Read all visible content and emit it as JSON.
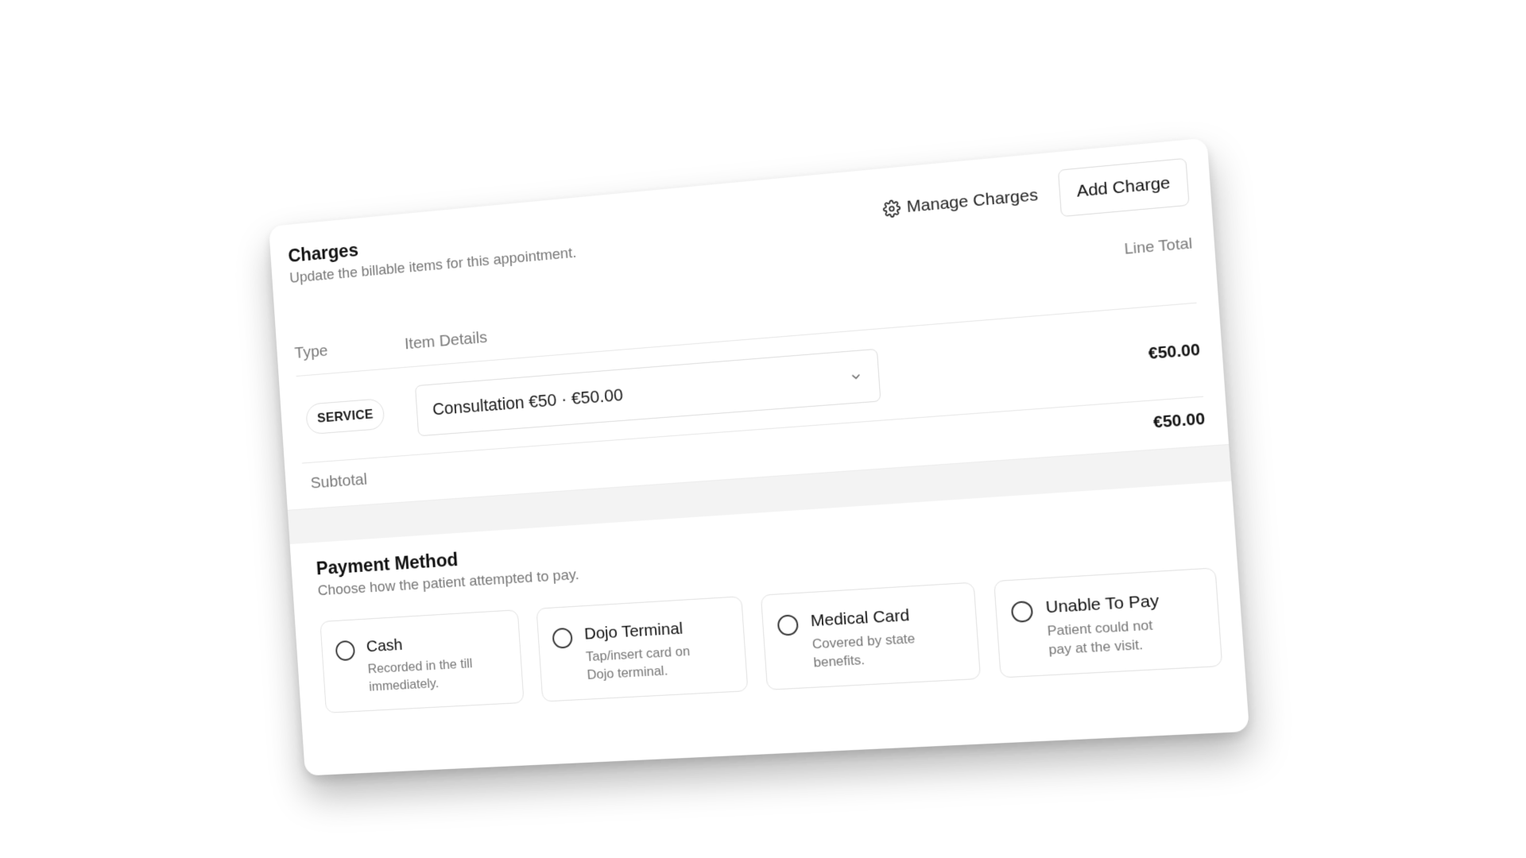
{
  "charges": {
    "title": "Charges",
    "subtitle": "Update the billable items for this appointment.",
    "manage_label": "Manage Charges",
    "add_label": "Add Charge",
    "columns": {
      "type": "Type",
      "details": "Item Details",
      "line_total": "Line Total"
    },
    "items": [
      {
        "type": "SERVICE",
        "details": "Consultation €50 · €50.00",
        "line_total": "€50.00"
      }
    ],
    "subtotal_label": "Subtotal",
    "subtotal_value": "€50.00"
  },
  "payment": {
    "title": "Payment Method",
    "subtitle": "Choose how the patient attempted to pay.",
    "options": [
      {
        "title": "Cash",
        "desc": "Recorded in the till immediately."
      },
      {
        "title": "Dojo Terminal",
        "desc": "Tap/insert card on Dojo terminal."
      },
      {
        "title": "Medical Card",
        "desc": "Covered by state benefits."
      },
      {
        "title": "Unable To Pay",
        "desc": "Patient could not pay at the visit."
      }
    ]
  },
  "icons": {
    "manage": "gear-icon",
    "select": "chevron-down-icon",
    "radio": "radio-unchecked-icon"
  }
}
